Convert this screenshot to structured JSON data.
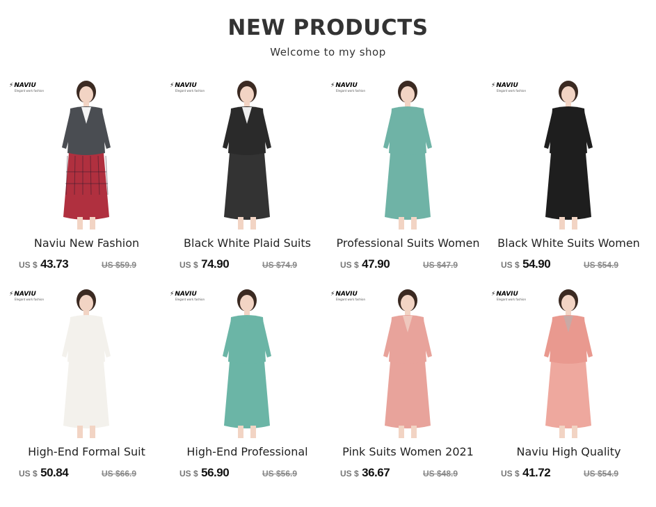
{
  "header": {
    "title": "NEW PRODUCTS",
    "subtitle": "Welcome to my shop"
  },
  "logo": {
    "brand": "NAVIU",
    "tagline": "Elegant work fashion"
  },
  "currency": "US $",
  "colors": {
    "title": "#333333",
    "price": "#111111",
    "old_price": "#888888"
  },
  "products": [
    {
      "name": "Naviu New Fashion",
      "price": "43.73",
      "old_price": "US $59.9",
      "outfit": {
        "top": "#4a4d52",
        "shirt": "#f4f4f4",
        "bottom": "#b0303f",
        "bottom_type": "skirt-plaid"
      }
    },
    {
      "name": "Black White Plaid Suits",
      "price": "74.90",
      "old_price": "US $74.9",
      "outfit": {
        "top": "#2a2a2a",
        "shirt": "#eeeeee",
        "bottom": "#333333",
        "bottom_type": "skirt"
      }
    },
    {
      "name": "Professional Suits Women",
      "price": "47.90",
      "old_price": "US $47.9",
      "outfit": {
        "top": "#6fb3a6",
        "shirt": "#6fb3a6",
        "bottom": "#6fb3a6",
        "bottom_type": "skirt"
      }
    },
    {
      "name": "Black White Suits Women",
      "price": "54.90",
      "old_price": "US $54.9",
      "outfit": {
        "top": "#1e1e1e",
        "shirt": "#1e1e1e",
        "bottom": "#1e1e1e",
        "bottom_type": "skirt"
      }
    },
    {
      "name": "High-End Formal Suit",
      "price": "50.84",
      "old_price": "US $66.9",
      "outfit": {
        "top": "#f3f1ec",
        "shirt": "#f3f1ec",
        "bottom": "#f3f1ec",
        "bottom_type": "skirt"
      }
    },
    {
      "name": "High-End Professional",
      "price": "56.90",
      "old_price": "US $56.9",
      "outfit": {
        "top": "#6bb5a6",
        "shirt": "#6bb5a6",
        "bottom": "#6bb5a6",
        "bottom_type": "skirt"
      }
    },
    {
      "name": "Pink Suits Women 2021",
      "price": "36.67",
      "old_price": "US $48.9",
      "outfit": {
        "top": "#e8a39b",
        "shirt": "#efc7bd",
        "bottom": "#e8a39b",
        "bottom_type": "skirt"
      }
    },
    {
      "name": "Naviu High Quality",
      "price": "41.72",
      "old_price": "US $54.9",
      "outfit": {
        "top": "#e9998f",
        "shirt": "#c9a9a5",
        "bottom": "#eea89e",
        "bottom_type": "skirt"
      }
    }
  ]
}
